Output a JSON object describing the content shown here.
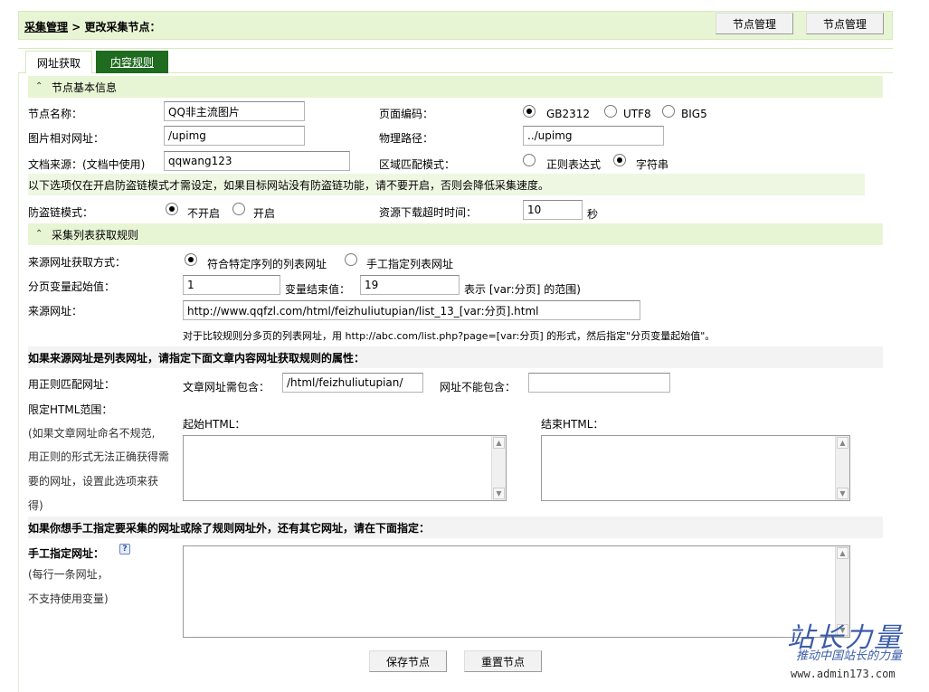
{
  "header": {
    "crumb_link": "采集管理",
    "crumb_sep": ">",
    "crumb_current": "更改采集节点：",
    "btn1": "节点管理",
    "btn2": "节点管理"
  },
  "tabs": [
    {
      "label": "网址获取",
      "active": false
    },
    {
      "label": "内容规则",
      "active": true
    }
  ],
  "basic": {
    "section_title": "节点基本信息",
    "node_name_label": "节点名称：",
    "node_name_value": "QQ非主流图片",
    "encoding_label": "页面编码：",
    "encoding_options": [
      "GB2312",
      "UTF8",
      "BIG5"
    ],
    "encoding_selected": "GB2312",
    "img_url_label": "图片相对网址：",
    "img_url_value": "/upimg",
    "phys_path_label": "物理路径：",
    "phys_path_value": "../upimg",
    "source_label": "文档来源：(文档中使用)",
    "source_value": "qqwang123",
    "match_mode_label": "区域匹配模式：",
    "match_options": [
      "正则表达式",
      "字符串"
    ],
    "match_selected": "字符串",
    "anti_leech_note": "以下选项仅在开启防盗链模式才需设定，如果目标网站没有防盗链功能，请不要开启，否则会降低采集速度。",
    "anti_leech_label": "防盗链模式：",
    "anti_leech_options": [
      "不开启",
      "开启"
    ],
    "anti_leech_selected": "不开启",
    "timeout_label": "资源下载超时时间：",
    "timeout_value": "10",
    "timeout_unit": "秒"
  },
  "list": {
    "section_title": "采集列表获取规则",
    "source_method_label": "来源网址获取方式：",
    "source_method_options": [
      "符合特定序列的列表网址",
      "手工指定列表网址"
    ],
    "source_method_selected": "符合特定序列的列表网址",
    "page_start_label": "分页变量起始值：",
    "page_start_value": "1",
    "page_end_label": "变量结束值：",
    "page_end_value": "19",
    "page_range_note": "表示 [var:分页] 的范围)",
    "source_url_label": "来源网址：",
    "source_url_value": "http://www.qqfzl.com/html/feizhuliutupian/list_13_[var:分页].html",
    "source_url_hint": "对于比较规则分多页的列表网址，用 http://abc.com/list.php?page=[var:分页] 的形式，然后指定\"分页变量起始值\"。"
  },
  "article": {
    "heading": "如果来源网址是列表网址，请指定下面文章内容网址获取规则的属性：",
    "regex_label": "用正则匹配网址：",
    "must_contain_label": "文章网址需包含：",
    "must_contain_value": "/html/feizhuliutupian/",
    "not_contain_label": "网址不能包含：",
    "not_contain_value": "",
    "html_range_label": "限定HTML范围：",
    "html_range_desc_1": "(如果文章网址命名不规范,",
    "html_range_desc_2": "用正则的形式无法正确获得需",
    "html_range_desc_3": "要的网址，设置此选项来获",
    "html_range_desc_4": "得)",
    "start_html_label": "起始HTML：",
    "end_html_label": "结束HTML："
  },
  "manual": {
    "heading": "如果你想手工指定要采集的网址或除了规则网址外，还有其它网址，请在下面指定：",
    "label": "手工指定网址：",
    "desc_1": "(每行一条网址，",
    "desc_2": "不支持使用变量)"
  },
  "footer": {
    "save": "保存节点",
    "reset": "重置节点"
  },
  "watermark": {
    "title": "站长力量",
    "slogan": "推动中国站长的力量",
    "url": "www.admin173.com"
  }
}
